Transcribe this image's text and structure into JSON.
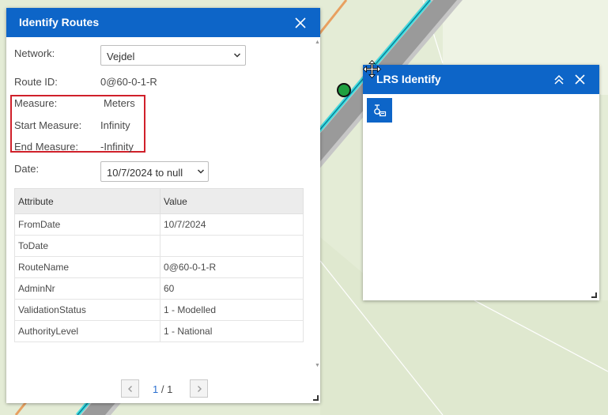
{
  "identify_routes": {
    "title": "Identify Routes",
    "network_label": "Network:",
    "network_value": "Vejdel",
    "route_id_label": "Route ID:",
    "route_id_value": "0@60-0-1-R",
    "measure_label": "Measure:",
    "measure_value": "Meters",
    "start_measure_label": "Start Measure:",
    "start_measure_value": "Infinity",
    "end_measure_label": "End Measure:",
    "end_measure_value": "-Infinity",
    "date_label": "Date:",
    "date_value": "10/7/2024 to null",
    "table": {
      "headers": [
        "Attribute",
        "Value"
      ],
      "rows": [
        [
          "FromDate",
          "10/7/2024"
        ],
        [
          "ToDate",
          ""
        ],
        [
          "RouteName",
          "0@60-0-1-R"
        ],
        [
          "AdminNr",
          "60"
        ],
        [
          "ValidationStatus",
          "1 - Modelled"
        ],
        [
          "AuthorityLevel",
          "1 - National"
        ]
      ]
    },
    "pager": {
      "current": "1",
      "separator": " / ",
      "total": "1"
    }
  },
  "lrs_identify": {
    "title": "LRS Identify",
    "tool_icon": "identify-route-tool-icon"
  },
  "colors": {
    "header_blue": "#0d65c8",
    "highlight_red": "#d0202a",
    "map_green": "#e4ecd6",
    "route_cyan": "#3fe0e0",
    "route_orange": "#e8a060"
  }
}
